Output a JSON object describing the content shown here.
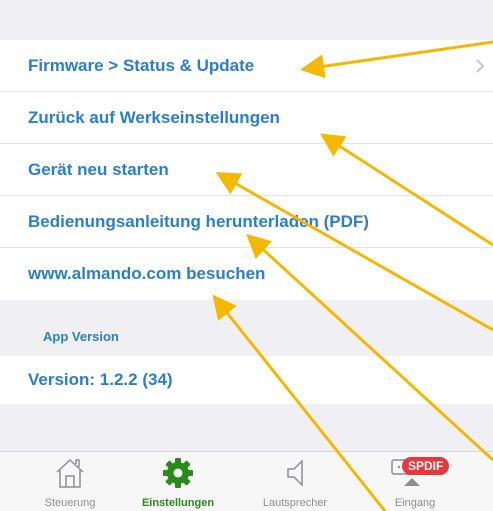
{
  "menu": {
    "items": [
      {
        "label": "Firmware > Status & Update",
        "chevron": true
      },
      {
        "label": "Zurück auf Werkseinstellungen"
      },
      {
        "label": "Gerät neu starten"
      },
      {
        "label": "Bedienungsanleitung herunterladen (PDF)"
      },
      {
        "label": "www.almando.com besuchen"
      }
    ]
  },
  "app_version": {
    "header": "App Version",
    "value": "Version: 1.2.2 (34)"
  },
  "tabbar": {
    "tabs": [
      {
        "label": "Steuerung",
        "icon": "house-icon"
      },
      {
        "label": "Einstellungen",
        "icon": "gear-icon",
        "active": true
      },
      {
        "label": "Lautsprecher",
        "icon": "speaker-icon"
      },
      {
        "label": "Eingang",
        "icon": "input-icon",
        "badge": "SPDIF"
      }
    ]
  },
  "colors": {
    "link_blue": "#2a7fcb",
    "active_green": "#2b8a1b",
    "annotation_arrow": "#f5b800",
    "badge_red": "#e8383d"
  }
}
